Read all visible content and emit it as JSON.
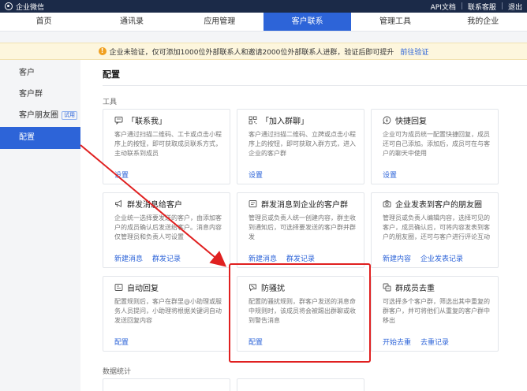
{
  "topbar": {
    "brand": "企业微信",
    "links": [
      "API文档",
      "联系客服",
      "退出"
    ]
  },
  "nav": {
    "items": [
      "首页",
      "通讯录",
      "应用管理",
      "客户联系",
      "管理工具",
      "我的企业"
    ],
    "active_index": 3
  },
  "notice": {
    "text": "企业未验证，仅可添加1000位外部联系人和邀请2000位外部联系人进群，验证后即可提升",
    "link": "前往验证"
  },
  "sidebar": {
    "items": [
      {
        "label": "客户"
      },
      {
        "label": "客户群"
      },
      {
        "label": "客户朋友圈",
        "badge": "试用"
      },
      {
        "label": "配置",
        "active": true
      }
    ]
  },
  "main": {
    "title": "配置",
    "section_tools": "工具",
    "section_stats": "数据统计",
    "cards": [
      {
        "icon": "chat-icon",
        "title": "「联系我」",
        "desc": "客户通过扫描二维码、工卡或点击小程序上的按钮，即可获取成员联系方式，主动联系到成员",
        "actions": [
          "设置"
        ]
      },
      {
        "icon": "qrcode-icon",
        "title": "「加入群聊」",
        "desc": "客户通过扫描二维码、立牌或点击小程序上的按钮，即可获取入群方式，进入企业的客户群",
        "actions": [
          "设置"
        ]
      },
      {
        "icon": "quick-reply-icon",
        "title": "快捷回复",
        "desc": "企业可为成员统一配置快捷回复，成员还可自己添加。添加后，成员可在与客户的聊天中使用",
        "actions": [
          "设置"
        ]
      },
      {
        "icon": "megaphone-icon",
        "title": "群发消息给客户",
        "desc": "企业统一选择要发送的客户，由添加客户的成员确认后发送给客户。消息内容仅管理员和负责人可设置",
        "actions": [
          "新建消息",
          "群发记录"
        ]
      },
      {
        "icon": "group-broadcast-icon",
        "title": "群发消息到企业的客户群",
        "desc": "管理员或负责人统一创建内容，群主收到通知后，可选择要发送的客户群并群发",
        "actions": [
          "新建消息",
          "群发记录"
        ]
      },
      {
        "icon": "camera-icon",
        "title": "企业发表到客户的朋友圈",
        "desc": "管理员或负责人编辑内容，选择可见的客户，成员确认后，可将内容发表到客户的朋友圈，还可与客户进行评论互动",
        "actions": [
          "新建内容",
          "企业发表记录"
        ]
      },
      {
        "icon": "auto-reply-icon",
        "title": "自动回复",
        "desc": "配置规则后，客户在群里@小助理或服务人员提问，小助理将根据关键词自动发送回复内容",
        "actions": [
          "配置"
        ]
      },
      {
        "icon": "anti-harass-icon",
        "title": "防骚扰",
        "desc": "配置防骚扰规则，群客户发送的消息命中规则时，该成员将会被踢出群聊或收到警告消息",
        "actions": [
          "配置"
        ]
      },
      {
        "icon": "dedupe-icon",
        "title": "群成员去重",
        "desc": "可选择多个客户群，筛选出其中重复的群客户，并可将他们从重复的客户群中移出",
        "actions": [
          "开始去重",
          "去重记录"
        ]
      }
    ]
  },
  "colors": {
    "topbar": "#1b2a48",
    "accent": "#2d64d8",
    "notice_bg": "#fdf6dd",
    "warning": "#f0a020",
    "annotation_red": "#e02020"
  }
}
